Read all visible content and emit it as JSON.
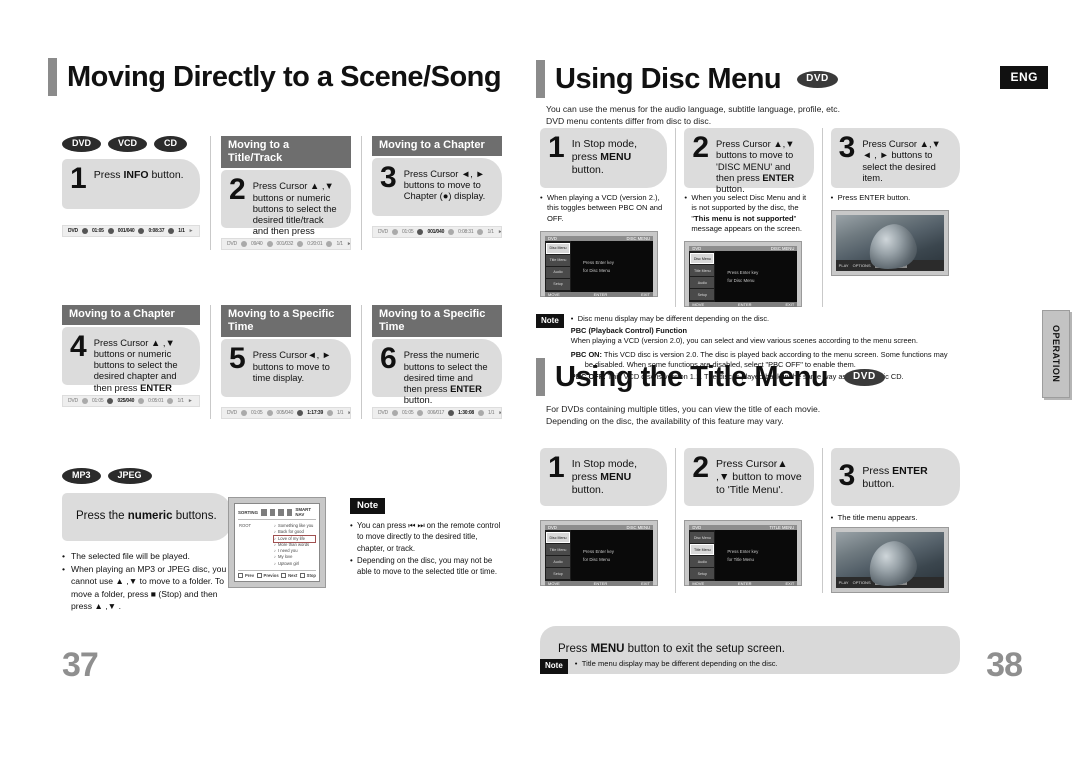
{
  "document": {
    "language_badge": "ENG",
    "side_tab": "OPERATION",
    "left_page_number": "37",
    "right_page_number": "38"
  },
  "left_page": {
    "heading": "Moving Directly to a Scene/Song",
    "media_tags": [
      "DVD",
      "VCD",
      "CD"
    ],
    "section_labels": {
      "title_track": "Moving to a Title/Track",
      "chapter": "Moving to a Chapter",
      "specific_time": "Moving to a Specific Time"
    },
    "steps": [
      {
        "number": "1",
        "text_html": "Press <b>INFO</b> button.",
        "osd": {
          "disc": "DVD",
          "title": "01:05",
          "chapter": "001/040",
          "time": "0:08:37",
          "extra": "1/1"
        }
      },
      {
        "number": "2",
        "text_html": "Press Cursor ▲ ,▼ buttons or numeric buttons to select the desired title/track and then press <b>ENTER</b> button.",
        "osd": {
          "disc": "DVD",
          "title": "09/40",
          "chapter": "001/032",
          "time": "0:20:01",
          "extra": "1/1"
        }
      },
      {
        "number": "3",
        "text_html": "Press Cursor ◄, ► buttons to move to Chapter (●) display.",
        "osd": {
          "disc": "DVD",
          "title": "01:05",
          "chapter": "001/040",
          "time": "0:08:31",
          "extra": "1/1"
        }
      },
      {
        "number": "4",
        "text_html": "Press Cursor ▲ ,▼ buttons or numeric buttons to select the desired chapter and then press <b>ENTER</b> button.",
        "osd": {
          "disc": "DVD",
          "title": "01:05",
          "chapter": "025/040",
          "time": "0:05:01",
          "extra": "1/1"
        }
      },
      {
        "number": "5",
        "text_html": "Press Cursor◄, ► buttons to move to time display.",
        "osd": {
          "disc": "DVD",
          "title": "01:05",
          "chapter": "005/040",
          "time": "1:17:39",
          "extra": "1/1"
        }
      },
      {
        "number": "6",
        "text_html": "Press the numeric buttons to select the desired time and then press <b>ENTER</b> button.",
        "osd": {
          "disc": "DVD",
          "title": "01:05",
          "chapter": "006/017",
          "time": "1:30:08",
          "extra": "1/1"
        }
      }
    ],
    "mp3_block": {
      "media_tags": [
        "MP3",
        "JPEG"
      ],
      "instruction_html": "Press the <b>numeric</b> buttons.",
      "bullets": [
        "The selected file will be played.",
        "When playing an MP3 or JPEG disc, you cannot use ▲ ,▼ to move to a folder. To move a folder, press ■ (Stop) and then press ▲ ,▼ ."
      ],
      "file_screen": {
        "title": "SORTING",
        "smart_nav": "SMART NAV",
        "root_label": "ROOT",
        "files": [
          "Something like you",
          "Back for good",
          "Love of my life",
          "More than words",
          "I need you",
          "My love",
          "Uptown girl"
        ],
        "selected_index": 2,
        "buttons": [
          "Prev",
          "Previos",
          "Next",
          "Stop"
        ]
      }
    },
    "note": {
      "badge": "Note",
      "bullets": [
        "You can press ⏮ ⏭ on the remote control to move directly to the desired title, chapter, or track.",
        "Depending on the disc, you may not be able to move to the selected title or time."
      ]
    }
  },
  "right_page": {
    "disc_menu": {
      "heading": "Using Disc Menu",
      "disc_pill": "DVD",
      "lead_lines": [
        "You can use the menus for the audio language, subtitle language, profile, etc.",
        "DVD menu contents differ from disc to disc."
      ],
      "steps": [
        {
          "number": "1",
          "text_html": "In Stop mode, press <b>MENU</b> button.",
          "bullets": [
            "When playing a VCD (version 2.), this toggles between PBC ON and OFF."
          ],
          "screen": {
            "top_left": "DVD",
            "top_right": "DISC MENU",
            "side_items": [
              "Disc Menu",
              "Title Menu",
              "Audio",
              "Setup"
            ],
            "selected_index": 0,
            "main_lines": [
              "Press Enter key",
              "for Disc Menu"
            ],
            "bottom": [
              "MOVE",
              "ENTER",
              "EXIT"
            ]
          }
        },
        {
          "number": "2",
          "text_html": "Press Cursor ▲,▼ buttons to move to 'DISC MENU' and then press <b>ENTER</b> button.",
          "bullets": [
            "When you select Disc Menu and it is not supported by the disc, the \"<b>This menu is not supported</b>\" message appears on the screen."
          ],
          "screen": {
            "top_left": "DVD",
            "top_right": "DISC MENU",
            "side_items": [
              "Disc Menu",
              "Title Menu",
              "Audio",
              "Setup"
            ],
            "selected_index": 0,
            "main_lines": [
              "Press Enter key",
              "for Disc Menu"
            ],
            "bottom": [
              "MOVE",
              "ENTER",
              "EXIT"
            ]
          }
        },
        {
          "number": "3",
          "text_html": "Press Cursor ▲,▼ ◄ , ► buttons to select the desired item.",
          "bullets": [
            "Press ENTER button."
          ],
          "screen": {
            "photo": true,
            "bar_items": [
              "PLAY",
              "OPTIONS",
              "SELECT ITEM"
            ]
          }
        }
      ],
      "note": {
        "badge": "Note",
        "bullet": "Disc menu display may be different depending on the disc.",
        "pbc_title": "PBC (Playback Control) Function",
        "pbc_intro": "When playing a VCD (version 2.0), you can select and view various scenes according to the menu screen.",
        "pbc_on_label": "PBC ON:",
        "pbc_on_text": "This VCD disc is version 2.0. The disc is played back according to the menu screen. Some functions may be disabled. When some functions are disabled, select \"PBC OFF\" to enable them.",
        "pbc_off_label": "PBC OFF:",
        "pbc_off_text": "This VCD disc is version 1.1. The disc is played back in the same way as with a music CD."
      }
    },
    "title_menu": {
      "heading": "Using the Title Menu",
      "disc_pill": "DVD",
      "lead_lines": [
        "For DVDs containing multiple titles, you can view the title of each movie.",
        "Depending on the disc, the availability of this feature may vary."
      ],
      "steps": [
        {
          "number": "1",
          "text_html": "In Stop mode, press <b>MENU</b> button.",
          "bullets": [],
          "screen": {
            "top_left": "DVD",
            "top_right": "DISC MENU",
            "side_items": [
              "Disc Menu",
              "Title Menu",
              "Audio",
              "Setup"
            ],
            "selected_index": 0,
            "main_lines": [
              "Press Enter key",
              "for Disc Menu"
            ],
            "bottom": [
              "MOVE",
              "ENTER",
              "EXIT"
            ]
          }
        },
        {
          "number": "2",
          "text_html": "Press Cursor▲ ,▼ button to move to 'Title Menu'.",
          "bullets": [],
          "screen": {
            "top_left": "DVD",
            "top_right": "TITLE MENU",
            "side_items": [
              "Disc Menu",
              "Title Menu",
              "Audio",
              "Setup"
            ],
            "selected_index": 1,
            "main_lines": [
              "Press Enter key",
              "for Title Menu"
            ],
            "bottom": [
              "MOVE",
              "ENTER",
              "EXIT"
            ]
          }
        },
        {
          "number": "3",
          "text_html": "Press <b>ENTER</b> button.",
          "bullets": [
            "The title menu appears."
          ],
          "screen": {
            "photo": true,
            "bar_items": [
              "PLAY",
              "OPTIONS",
              "SELECT ITEM"
            ]
          }
        }
      ],
      "exit_instruction_html": "Press <b>MENU</b> button to exit the setup screen.",
      "note": {
        "badge": "Note",
        "bullet": "Title menu display may be different depending on the disc."
      }
    }
  }
}
